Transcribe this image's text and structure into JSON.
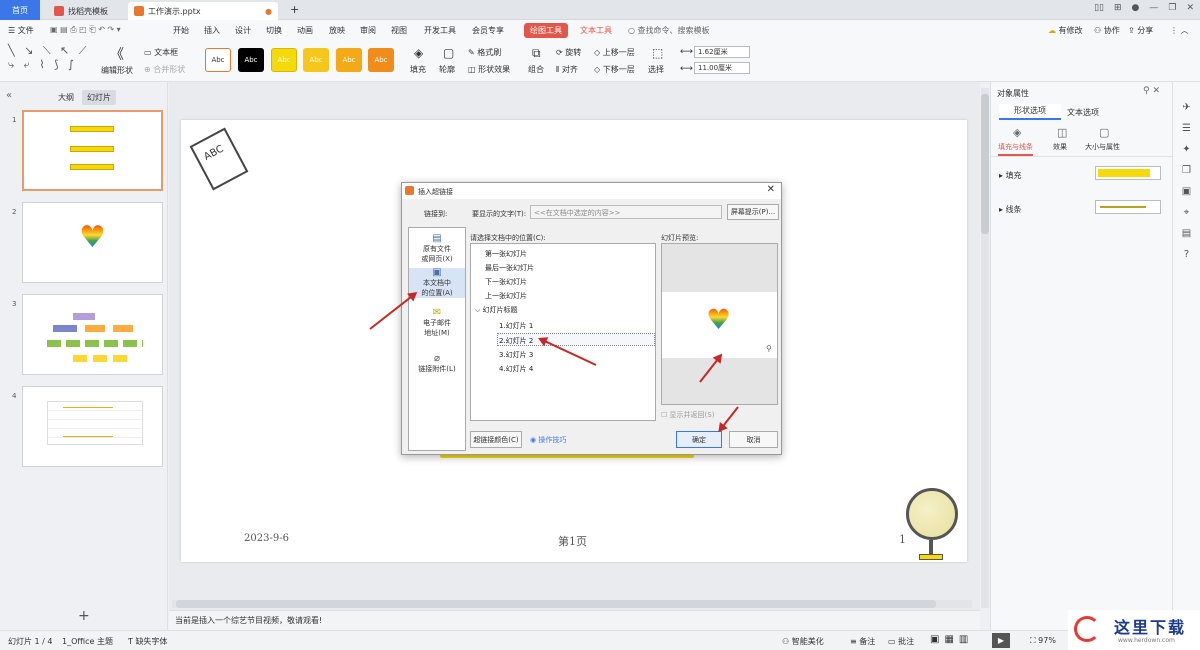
{
  "tabs": {
    "home": "首页",
    "template": "找稻壳模板",
    "file": "工作演示.pptx"
  },
  "menu": {
    "file": "文件",
    "items": [
      "开始",
      "插入",
      "设计",
      "切换",
      "动画",
      "放映",
      "审阅",
      "视图",
      "开发工具",
      "会员专享"
    ],
    "drawing_tool": "绘图工具",
    "text_tool": "文本工具",
    "search": "查找命令、搜索模板",
    "right": [
      "有修改",
      "协作",
      "分享"
    ]
  },
  "ribbon": {
    "edit_shape": "编辑形状",
    "textbox": "文本框",
    "merge_shape": "合并形状",
    "styles": [
      "Abc",
      "Abc",
      "Abc",
      "Abc",
      "Abc",
      "Abc"
    ],
    "fill": "填充",
    "outline": "轮廓",
    "format_painter": "格式刷",
    "shape_effect": "形状效果",
    "combine": "组合",
    "rotate": "旋转",
    "align": "对齐",
    "bring_forward": "上移一层",
    "send_backward": "下移一层",
    "select": "选择",
    "height": "1.62厘米",
    "width": "11.00厘米"
  },
  "left_panel": {
    "tab_outline": "大纲",
    "tab_slides": "幻灯片",
    "add": "+"
  },
  "slide": {
    "date": "2023-9-6",
    "page": "第1页",
    "num": "1",
    "abc": "ABC"
  },
  "notes": "当前是插入一个综艺节目视频，敬请观看!",
  "status": {
    "slide_info": "幻灯片 1 / 4",
    "theme": "1_Office 主题",
    "missing_font": "缺失字体",
    "beautify": "智能美化",
    "notes": "备注",
    "comment": "批注",
    "zoom": "97%"
  },
  "right_panel": {
    "title": "对象属性",
    "tab_shape": "形状选项",
    "tab_text": "文本选项",
    "sub_fill_line": "填充与线条",
    "sub_effect": "效果",
    "sub_size": "大小与属性",
    "fill": "填充",
    "line": "线条",
    "fill_color": "#f5d90a",
    "line_color": "#b8a020"
  },
  "dialog": {
    "title": "插入超链接",
    "link_to": "链接到:",
    "display_text_label": "要显示的文字(T):",
    "display_text_value": "<<在文档中选定的内容>>",
    "screen_tip": "屏幕提示(P)...",
    "nav": [
      "原有文件\n或网页(X)",
      "本文档中\n的位置(A)",
      "电子邮件\n地址(M)",
      "链接附件(L)"
    ],
    "location_label": "请选择文档中的位置(C):",
    "preview_label": "幻灯片预览:",
    "locations": [
      "第一张幻灯片",
      "最后一张幻灯片",
      "下一张幻灯片",
      "上一张幻灯片",
      "幻灯片标题"
    ],
    "slides": [
      "1.幻灯片 1",
      "2.幻灯片 2",
      "3.幻灯片 3",
      "4.幻灯片 4"
    ],
    "show_return": "显示并返回(S)",
    "link_color": "超链接颜色(C)",
    "tips": "操作技巧",
    "ok": "确定",
    "cancel": "取消"
  },
  "watermark": {
    "text": "这里下载",
    "url": "www.herdown.com"
  }
}
